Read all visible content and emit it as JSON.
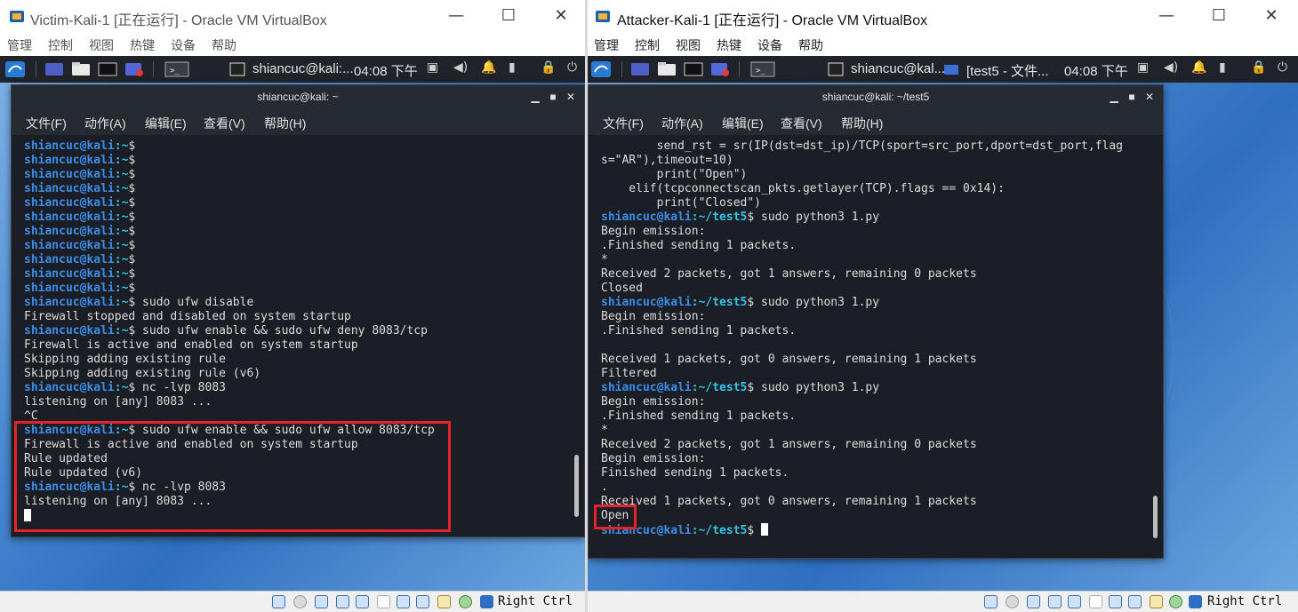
{
  "left": {
    "window_title": "Victim-Kali-1 [正在运行] - Oracle VM VirtualBox",
    "menus": [
      "管理",
      "控制",
      "视图",
      "热键",
      "设备",
      "帮助"
    ],
    "panel_task": "shiancuc@kali:...",
    "clock": "04:08 下午",
    "terminal": {
      "title": "shiancuc@kali: ~",
      "menus": [
        "文件(F)",
        "动作(A)",
        "编辑(E)",
        "查看(V)",
        "帮助(H)"
      ],
      "user_host": "shiancuc@kali",
      "prompt_path": ":~",
      "lines": [
        {
          "p": true,
          "cmd": ""
        },
        {
          "p": true,
          "cmd": ""
        },
        {
          "p": true,
          "cmd": ""
        },
        {
          "p": true,
          "cmd": ""
        },
        {
          "p": true,
          "cmd": ""
        },
        {
          "p": true,
          "cmd": ""
        },
        {
          "p": true,
          "cmd": ""
        },
        {
          "p": true,
          "cmd": ""
        },
        {
          "p": true,
          "cmd": ""
        },
        {
          "p": true,
          "cmd": ""
        },
        {
          "p": true,
          "cmd": ""
        },
        {
          "p": true,
          "cmd": " sudo ufw disable"
        },
        {
          "p": false,
          "text": "Firewall stopped and disabled on system startup"
        },
        {
          "p": true,
          "cmd": " sudo ufw enable && sudo ufw deny 8083/tcp"
        },
        {
          "p": false,
          "text": "Firewall is active and enabled on system startup"
        },
        {
          "p": false,
          "text": "Skipping adding existing rule"
        },
        {
          "p": false,
          "text": "Skipping adding existing rule (v6)"
        },
        {
          "p": true,
          "cmd": " nc -lvp 8083"
        },
        {
          "p": false,
          "text": "listening on [any] 8083 ..."
        },
        {
          "p": false,
          "text": "^C"
        },
        {
          "p": true,
          "cmd": " sudo ufw enable && sudo ufw allow 8083/tcp"
        },
        {
          "p": false,
          "text": "Firewall is active and enabled on system startup"
        },
        {
          "p": false,
          "text": "Rule updated"
        },
        {
          "p": false,
          "text": "Rule updated (v6)"
        },
        {
          "p": true,
          "cmd": " nc -lvp 8083"
        },
        {
          "p": false,
          "text": "listening on [any] 8083 ..."
        },
        {
          "p": false,
          "text": "",
          "cursor": true
        }
      ]
    },
    "host_key": "Right Ctrl"
  },
  "right": {
    "window_title": "Attacker-Kali-1 [正在运行] - Oracle VM VirtualBox",
    "menus": [
      "管理",
      "控制",
      "视图",
      "热键",
      "设备",
      "帮助"
    ],
    "panel_task": "shiancuc@kal...",
    "panel_task2": "[test5 - 文件...",
    "clock": "04:08 下午",
    "terminal": {
      "title": "shiancuc@kali: ~/test5",
      "menus": [
        "文件(F)",
        "动作(A)",
        "编辑(E)",
        "查看(V)",
        "帮助(H)"
      ],
      "user_host": "shiancuc@kali",
      "prompt_path": ":~/test5",
      "lines": [
        {
          "p": false,
          "text": "        send_rst = sr(IP(dst=dst_ip)/TCP(sport=src_port,dport=dst_port,flag"
        },
        {
          "p": false,
          "text": "s=\"AR\"),timeout=10)"
        },
        {
          "p": false,
          "text": "        print(\"Open\")"
        },
        {
          "p": false,
          "text": "    elif(tcpconnectscan_pkts.getlayer(TCP).flags == 0x14):"
        },
        {
          "p": false,
          "text": "        print(\"Closed\")"
        },
        {
          "p": true,
          "cmd": " sudo python3 1.py"
        },
        {
          "p": false,
          "text": "Begin emission:"
        },
        {
          "p": false,
          "text": ".Finished sending 1 packets."
        },
        {
          "p": false,
          "text": "*"
        },
        {
          "p": false,
          "text": "Received 2 packets, got 1 answers, remaining 0 packets"
        },
        {
          "p": false,
          "text": "Closed"
        },
        {
          "p": true,
          "cmd": " sudo python3 1.py"
        },
        {
          "p": false,
          "text": "Begin emission:"
        },
        {
          "p": false,
          "text": ".Finished sending 1 packets."
        },
        {
          "p": false,
          "text": ""
        },
        {
          "p": false,
          "text": "Received 1 packets, got 0 answers, remaining 1 packets"
        },
        {
          "p": false,
          "text": "Filtered"
        },
        {
          "p": true,
          "cmd": " sudo python3 1.py"
        },
        {
          "p": false,
          "text": "Begin emission:"
        },
        {
          "p": false,
          "text": ".Finished sending 1 packets."
        },
        {
          "p": false,
          "text": "*"
        },
        {
          "p": false,
          "text": "Received 2 packets, got 1 answers, remaining 0 packets"
        },
        {
          "p": false,
          "text": "Begin emission:"
        },
        {
          "p": false,
          "text": "Finished sending 1 packets."
        },
        {
          "p": false,
          "text": "."
        },
        {
          "p": false,
          "text": "Received 1 packets, got 0 answers, remaining 1 packets"
        },
        {
          "p": false,
          "text": "Open"
        },
        {
          "p": true,
          "cmd": " ",
          "cursor": true
        }
      ]
    },
    "host_key": "Right Ctrl"
  },
  "colors": {
    "highlight": "#e3242b",
    "prompt_user": "#3b8eea",
    "prompt_path": "#2ec5e8",
    "terminal_bg": "#1b1e24"
  }
}
